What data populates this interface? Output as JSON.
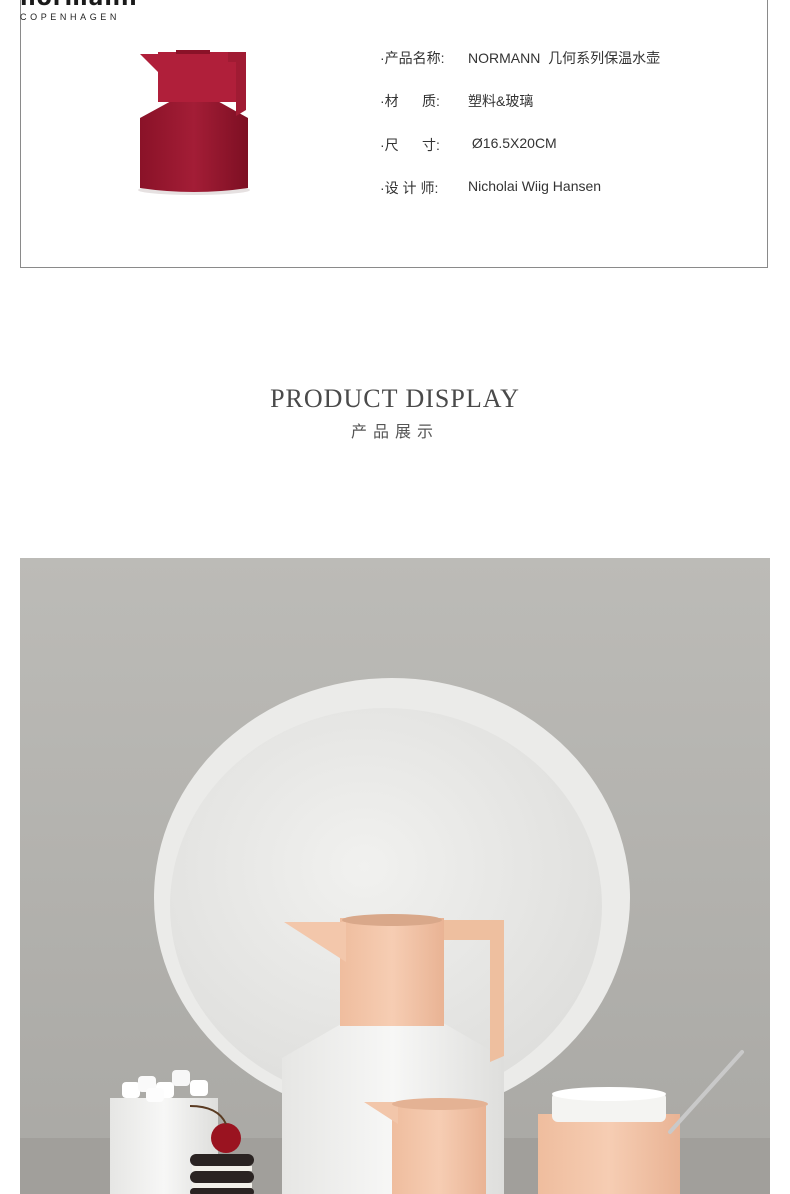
{
  "brand": {
    "name": "normann",
    "subtitle": "COPENHAGEN"
  },
  "product_image": {
    "subject": "red-geometric-vacuum-jug",
    "color": "#9e1b32"
  },
  "specs": [
    {
      "label": "·产品名称:",
      "value": "NORMANN  几何系列保温水壶"
    },
    {
      "label": "·材      质:",
      "value": "塑料&玻璃"
    },
    {
      "label": "·尺      寸:",
      "value": " Ø16.5X20CM"
    },
    {
      "label": "·设 计 师:",
      "value": "Nicholai Wiig Hansen"
    }
  ],
  "section": {
    "title": "PRODUCT DISPLAY",
    "subtitle": "产品展示"
  },
  "display_photo": {
    "subject": "peach-jug-set-with-tray",
    "accent": "#f2c4a9",
    "background": "#b9b8b4"
  }
}
